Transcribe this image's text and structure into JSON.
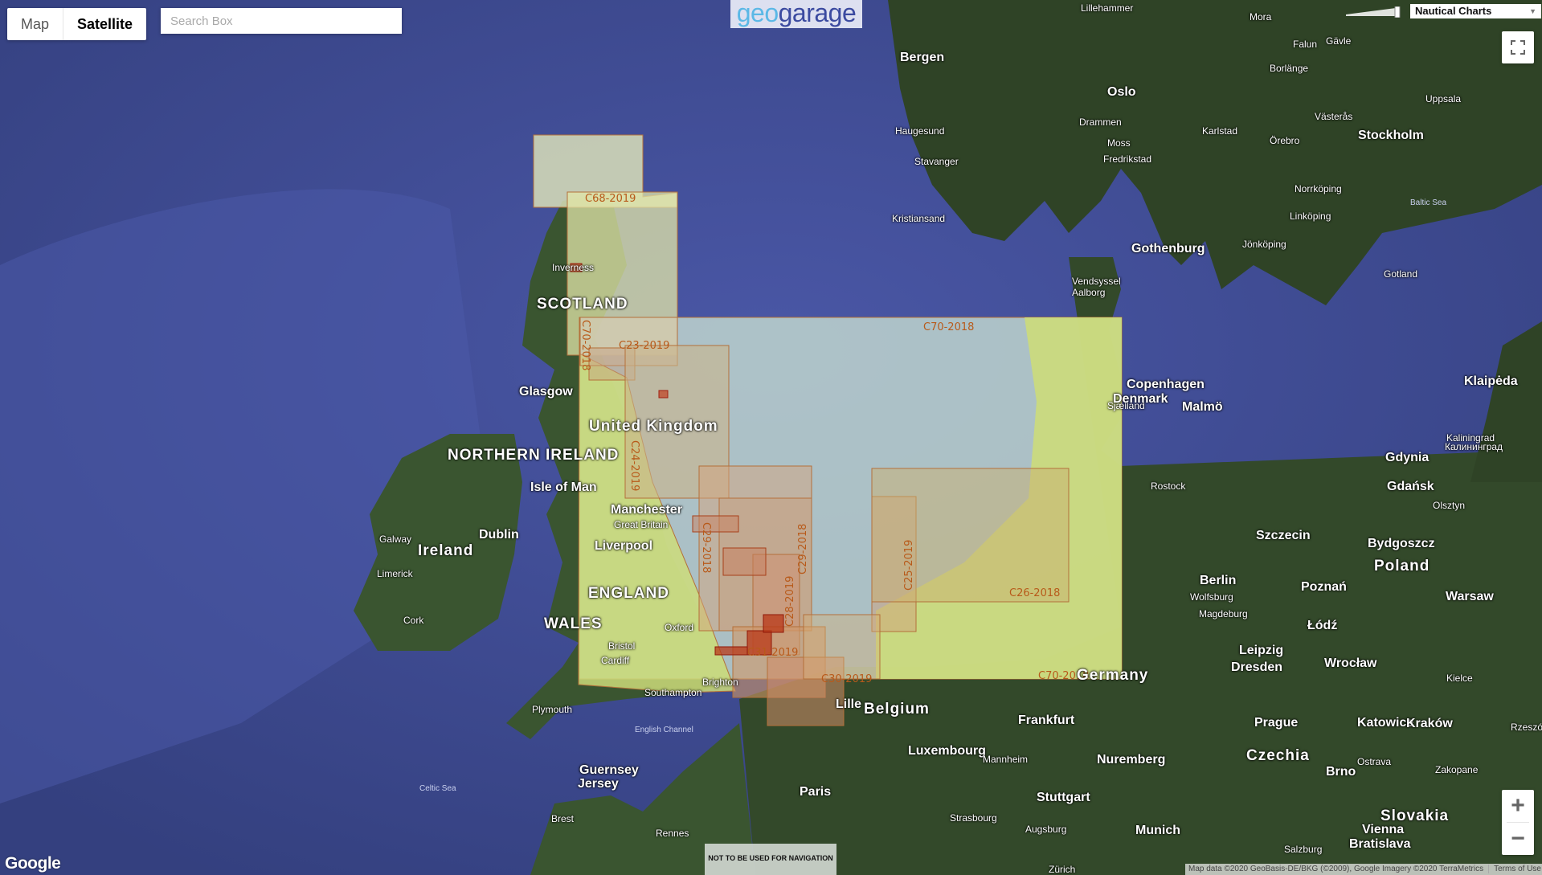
{
  "map_type_control": {
    "options": [
      {
        "label": "Map",
        "active": false
      },
      {
        "label": "Satellite",
        "active": true
      }
    ]
  },
  "search": {
    "placeholder": "Search Box",
    "value": ""
  },
  "logo": {
    "part1": "geo",
    "part2": "garage"
  },
  "layer_select": {
    "selected": "Nautical Charts"
  },
  "opacity_slider": {
    "value_fraction": 1.0
  },
  "controls": {
    "fullscreen_icon": "fullscreen-icon",
    "zoom_in": "+",
    "zoom_out": "−"
  },
  "google_logo": "Google",
  "attribution": {
    "text": "Map data ©2020 GeoBasis-DE/BKG (©2009), Google Imagery ©2020 TerraMetrics",
    "terms": "Terms of Use"
  },
  "disclaimer": "NOT TO BE USED FOR NAVIGATION",
  "chart_labels": [
    "C68-2019",
    "C70-2018",
    "C23-2019",
    "C24-2019",
    "C29-2018",
    "C28-2019",
    "C29-2018",
    "C25-2019",
    "C26-2018",
    "C30-2019",
    "C70-2018",
    "C31-2019",
    "C70-2018"
  ],
  "places": [
    {
      "name": "Lillehammer",
      "cls": ""
    },
    {
      "name": "Mora",
      "cls": ""
    },
    {
      "name": "Gävle",
      "cls": ""
    },
    {
      "name": "Falun",
      "cls": ""
    },
    {
      "name": "Borlänge",
      "cls": ""
    },
    {
      "name": "Bergen",
      "cls": "big"
    },
    {
      "name": "Oslo",
      "cls": "big"
    },
    {
      "name": "Uppsala",
      "cls": ""
    },
    {
      "name": "Drammen",
      "cls": ""
    },
    {
      "name": "Västerås",
      "cls": ""
    },
    {
      "name": "Haugesund",
      "cls": ""
    },
    {
      "name": "Karlstad",
      "cls": ""
    },
    {
      "name": "Moss",
      "cls": ""
    },
    {
      "name": "Örebro",
      "cls": ""
    },
    {
      "name": "Stockholm",
      "cls": "big"
    },
    {
      "name": "Fredrikstad",
      "cls": ""
    },
    {
      "name": "Stavanger",
      "cls": ""
    },
    {
      "name": "Norrköping",
      "cls": ""
    },
    {
      "name": "Linköping",
      "cls": ""
    },
    {
      "name": "Baltic Sea",
      "cls": "sea"
    },
    {
      "name": "Kristiansand",
      "cls": ""
    },
    {
      "name": "Jönköping",
      "cls": ""
    },
    {
      "name": "Gothenburg",
      "cls": "big"
    },
    {
      "name": "Gotland",
      "cls": ""
    },
    {
      "name": "Vendsyssel",
      "cls": ""
    },
    {
      "name": "Aalborg",
      "cls": ""
    },
    {
      "name": "Copenhagen",
      "cls": "big"
    },
    {
      "name": "Sjælland",
      "cls": ""
    },
    {
      "name": "Malmö",
      "cls": "big"
    },
    {
      "name": "Klaipėda",
      "cls": "big"
    },
    {
      "name": "Kaliningrad",
      "cls": ""
    },
    {
      "name": "Калининград",
      "cls": ""
    },
    {
      "name": "Gdynia",
      "cls": "big"
    },
    {
      "name": "Gdańsk",
      "cls": "big"
    },
    {
      "name": "Olsztyn",
      "cls": ""
    },
    {
      "name": "Rostock",
      "cls": ""
    },
    {
      "name": "Szczecin",
      "cls": "big"
    },
    {
      "name": "Bydgoszcz",
      "cls": "big"
    },
    {
      "name": "Poland",
      "cls": "country"
    },
    {
      "name": "Berlin",
      "cls": "big"
    },
    {
      "name": "Poznań",
      "cls": "big"
    },
    {
      "name": "Warsaw",
      "cls": "big"
    },
    {
      "name": "Wolfsburg",
      "cls": ""
    },
    {
      "name": "Magdeburg",
      "cls": ""
    },
    {
      "name": "Łódź",
      "cls": "big"
    },
    {
      "name": "Leipzig",
      "cls": "big"
    },
    {
      "name": "Dresden",
      "cls": "big"
    },
    {
      "name": "Wrocław",
      "cls": "big"
    },
    {
      "name": "Kielce",
      "cls": ""
    },
    {
      "name": "Germany",
      "cls": "country"
    },
    {
      "name": "Frankfurt",
      "cls": "big"
    },
    {
      "name": "Prague",
      "cls": "big"
    },
    {
      "name": "Katowice",
      "cls": "big"
    },
    {
      "name": "Kraków",
      "cls": "big"
    },
    {
      "name": "Rzeszó",
      "cls": ""
    },
    {
      "name": "Czechia",
      "cls": "country"
    },
    {
      "name": "Ostrava",
      "cls": ""
    },
    {
      "name": "Luxembourg",
      "cls": "big"
    },
    {
      "name": "Mannheim",
      "cls": ""
    },
    {
      "name": "Nuremberg",
      "cls": "big"
    },
    {
      "name": "Zakopane",
      "cls": ""
    },
    {
      "name": "Brno",
      "cls": "big"
    },
    {
      "name": "Stuttgart",
      "cls": "big"
    },
    {
      "name": "Slovakia",
      "cls": "country"
    },
    {
      "name": "Strasbourg",
      "cls": ""
    },
    {
      "name": "Augsburg",
      "cls": ""
    },
    {
      "name": "Munich",
      "cls": "big"
    },
    {
      "name": "Vienna",
      "cls": "big"
    },
    {
      "name": "Bratislava",
      "cls": "big"
    },
    {
      "name": "Salzburg",
      "cls": ""
    },
    {
      "name": "Zürich",
      "cls": ""
    },
    {
      "name": "Belgium",
      "cls": "country"
    },
    {
      "name": "Lille",
      "cls": "big"
    },
    {
      "name": "Paris",
      "cls": "big"
    },
    {
      "name": "Rennes",
      "cls": ""
    },
    {
      "name": "Brest",
      "cls": ""
    },
    {
      "name": "Guernsey",
      "cls": "big"
    },
    {
      "name": "Jersey",
      "cls": "big"
    },
    {
      "name": "English Channel",
      "cls": "sea"
    },
    {
      "name": "Celtic Sea",
      "cls": "sea"
    },
    {
      "name": "Plymouth",
      "cls": ""
    },
    {
      "name": "Southampton",
      "cls": ""
    },
    {
      "name": "Brighton",
      "cls": ""
    },
    {
      "name": "Cardiff",
      "cls": ""
    },
    {
      "name": "Bristol",
      "cls": ""
    },
    {
      "name": "Oxford",
      "cls": ""
    },
    {
      "name": "WALES",
      "cls": "country"
    },
    {
      "name": "ENGLAND",
      "cls": "country"
    },
    {
      "name": "Liverpool",
      "cls": "big"
    },
    {
      "name": "Manchester",
      "cls": "big"
    },
    {
      "name": "Great Britain",
      "cls": ""
    },
    {
      "name": "Isle of Man",
      "cls": "big"
    },
    {
      "name": "Dublin",
      "cls": "big"
    },
    {
      "name": "Ireland",
      "cls": "country"
    },
    {
      "name": "Galway",
      "cls": ""
    },
    {
      "name": "Limerick",
      "cls": ""
    },
    {
      "name": "Cork",
      "cls": ""
    },
    {
      "name": "NORTHERN IRELAND",
      "cls": "country"
    },
    {
      "name": "United Kingdom",
      "cls": "country"
    },
    {
      "name": "Glasgow",
      "cls": "big"
    },
    {
      "name": "SCOTLAND",
      "cls": "country"
    },
    {
      "name": "Inverness",
      "cls": ""
    },
    {
      "name": "Denmark",
      "cls": "big"
    }
  ]
}
